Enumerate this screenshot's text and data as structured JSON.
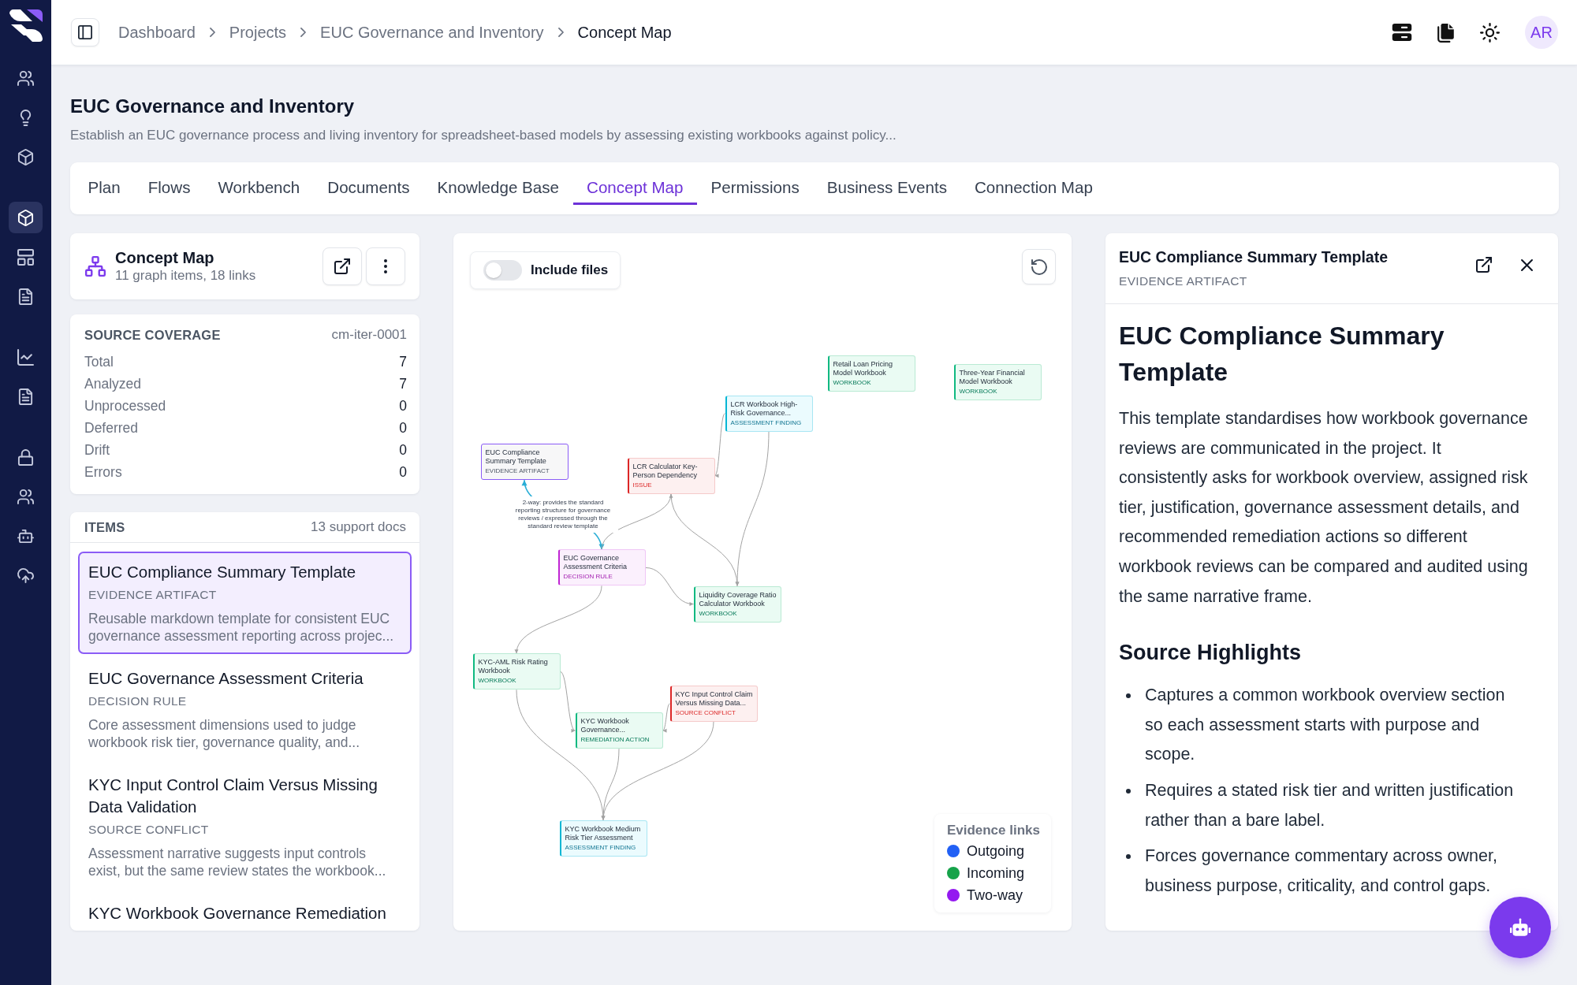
{
  "sidebar": {
    "groups": [
      [
        {
          "selected": false
        },
        {
          "selected": false
        },
        {
          "selected": false
        }
      ],
      [
        {
          "selected": true
        },
        {
          "selected": false
        },
        {
          "selected": false
        }
      ],
      [
        {
          "selected": false
        },
        {
          "selected": false
        }
      ],
      [
        {
          "selected": false
        },
        {
          "selected": false
        },
        {
          "selected": false
        },
        {
          "selected": false
        }
      ]
    ]
  },
  "breadcrumbs": [
    {
      "label": "Dashboard",
      "current": false
    },
    {
      "label": "Projects",
      "current": false
    },
    {
      "label": "EUC Governance and Inventory",
      "current": false
    },
    {
      "label": "Concept Map",
      "current": true
    }
  ],
  "user": {
    "initials": "AR"
  },
  "project": {
    "title": "EUC Governance and Inventory",
    "description": "Establish an EUC governance process and living inventory for spreadsheet-based models by assessing existing workbooks against policy..."
  },
  "tabs": [
    {
      "label": "Plan",
      "selected": false
    },
    {
      "label": "Flows",
      "selected": false
    },
    {
      "label": "Workbench",
      "selected": false
    },
    {
      "label": "Documents",
      "selected": false
    },
    {
      "label": "Knowledge Base",
      "selected": false
    },
    {
      "label": "Concept Map",
      "selected": true
    },
    {
      "label": "Permissions",
      "selected": false
    },
    {
      "label": "Business Events",
      "selected": false
    },
    {
      "label": "Connection Map",
      "selected": false
    }
  ],
  "map_card": {
    "title": "Concept Map",
    "subtitle": "11 graph items, 18 links"
  },
  "coverage": {
    "title": "SOURCE COVERAGE",
    "iteration": "cm-iter-0001",
    "rows": [
      {
        "label": "Total",
        "value": "7"
      },
      {
        "label": "Analyzed",
        "value": "7"
      },
      {
        "label": "Unprocessed",
        "value": "0"
      },
      {
        "label": "Deferred",
        "value": "0"
      },
      {
        "label": "Drift",
        "value": "0"
      },
      {
        "label": "Errors",
        "value": "0"
      }
    ]
  },
  "items": {
    "title": "ITEMS",
    "count": "13 support docs",
    "list": [
      {
        "title": "EUC Compliance Summary Template",
        "type": "EVIDENCE ARTIFACT",
        "description": "Reusable markdown template for consistent EUC governance assessment reporting across projec...",
        "selected": true
      },
      {
        "title": "EUC Governance Assessment Criteria",
        "type": "DECISION RULE",
        "description": "Core assessment dimensions used to judge workbook risk tier, governance quality, and...",
        "selected": false
      },
      {
        "title": "KYC Input Control Claim Versus Missing Data Validation",
        "type": "SOURCE CONFLICT",
        "description": "Assessment narrative suggests input controls exist, but the same review states the workbook...",
        "selected": false
      },
      {
        "title": "KYC Workbook Governance Remediation",
        "selected": false
      }
    ]
  },
  "graph": {
    "include_files": {
      "label": "Include files",
      "on": false
    },
    "nodes": [
      {
        "title": "Retail Loan Pricing Model Workbook",
        "type": "WORKBOOK",
        "kind": "workbook",
        "selected": false
      },
      {
        "title": "Three-Year Financial Model Workbook",
        "type": "WORKBOOK",
        "kind": "workbook",
        "selected": false
      },
      {
        "title": "LCR Workbook High-Risk Governance...",
        "type": "ASSESSMENT FINDING",
        "kind": "finding",
        "selected": false
      },
      {
        "title": "EUC Compliance Summary Template",
        "type": "EVIDENCE ARTIFACT",
        "kind": "artifact",
        "selected": true
      },
      {
        "title": "LCR Calculator Key-Person Dependency",
        "type": "ISSUE",
        "kind": "issue",
        "selected": false
      },
      {
        "title": "EUC Governance Assessment Criteria",
        "type": "DECISION RULE",
        "kind": "rule",
        "selected": false
      },
      {
        "title": "Liquidity Coverage Ratio Calculator Workbook",
        "type": "WORKBOOK",
        "kind": "workbook",
        "selected": false
      },
      {
        "title": "KYC-AML Risk Rating Workbook",
        "type": "WORKBOOK",
        "kind": "workbook",
        "selected": false
      },
      {
        "title": "KYC Input Control Claim Versus Missing Data...",
        "type": "SOURCE CONFLICT",
        "kind": "conflict",
        "selected": false
      },
      {
        "title": "KYC Workbook Governance...",
        "type": "REMEDIATION ACTION",
        "kind": "remediation",
        "selected": false
      },
      {
        "title": "KYC Workbook Medium Risk Tier Assessment",
        "type": "ASSESSMENT FINDING",
        "kind": "finding",
        "selected": false
      }
    ],
    "links": [
      {
        "kind": "two-way",
        "label": "2-way: provides the standard reporting structure for governance reviews / expressed through the standard review template"
      },
      {
        "kind": "one-way"
      },
      {
        "kind": "one-way"
      },
      {
        "kind": "one-way"
      },
      {
        "kind": "one-way"
      },
      {
        "kind": "one-way"
      },
      {
        "kind": "one-way"
      },
      {
        "kind": "one-way"
      },
      {
        "kind": "one-way"
      },
      {
        "kind": "one-way"
      },
      {
        "kind": "one-way"
      },
      {
        "kind": "one-way"
      }
    ],
    "legend": {
      "title": "Evidence links",
      "items": [
        {
          "label": "Outgoing",
          "color": "#2160f5"
        },
        {
          "label": "Incoming",
          "color": "#16a34a"
        },
        {
          "label": "Two-way",
          "color": "#9419f0"
        }
      ]
    }
  },
  "detail": {
    "title": "EUC Compliance Summary Template",
    "type": "EVIDENCE ARTIFACT",
    "heading": "EUC Compliance Summary Template",
    "paragraph": "This template standardises how workbook governance reviews are communicated in the project. It consistently asks for workbook overview, assigned risk tier, justification, governance assessment details, and recommended remediation actions so different workbook reviews can be compared and audited using the same narrative frame.",
    "section": "Source Highlights",
    "bullets": [
      "Captures a common workbook overview section so each assessment starts with purpose and scope.",
      "Requires a stated risk tier and written justification rather than a bare label.",
      "Forces governance commentary across owner, business purpose, criticality, and control gaps."
    ]
  }
}
